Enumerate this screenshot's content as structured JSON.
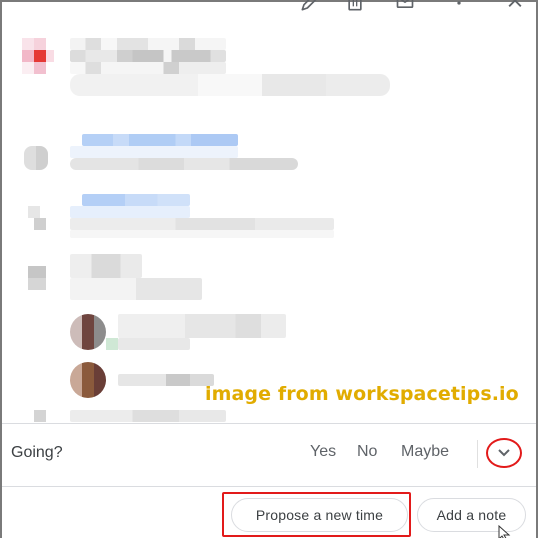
{
  "toolbar": {
    "icons": [
      {
        "name": "edit-icon"
      },
      {
        "name": "delete-icon"
      },
      {
        "name": "email-icon"
      },
      {
        "name": "more-options-icon"
      },
      {
        "name": "close-icon"
      }
    ]
  },
  "event_details": {
    "blurred": true,
    "accent_color": "#e53935",
    "link_color": "#a8c7fa"
  },
  "watermark": {
    "text": "image from workspacetips.io",
    "color": "#e1ac00"
  },
  "rsvp": {
    "label": "Going?",
    "options": [
      "Yes",
      "No",
      "Maybe"
    ],
    "expand_icon": "chevron-down-icon"
  },
  "actions": {
    "propose_label": "Propose a new time",
    "note_label": "Add a note"
  },
  "annotations": {
    "highlight_color": "#e21a1a"
  }
}
